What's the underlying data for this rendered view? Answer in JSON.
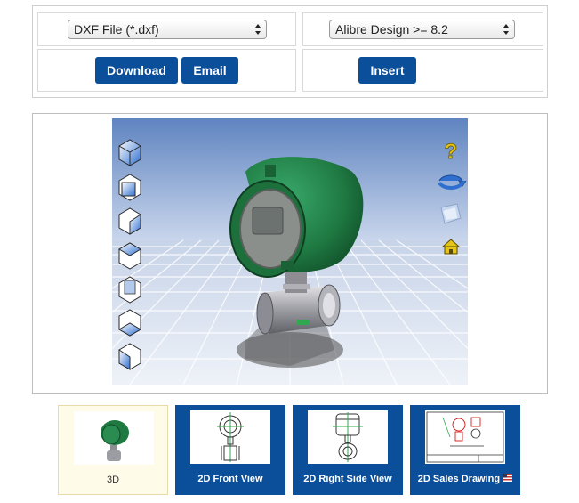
{
  "download_panel": {
    "format_select": {
      "value": "DXF File (*.dxf)"
    },
    "download_label": "Download",
    "email_label": "Email"
  },
  "insert_panel": {
    "cad_select": {
      "value": "Alibre Design >= 8.2"
    },
    "insert_label": "Insert"
  },
  "viewer": {
    "left_toolbar": [
      "view-cube-iso-icon",
      "view-cube-front-icon",
      "view-cube-right-icon",
      "view-cube-top-icon",
      "view-cube-back-icon",
      "view-cube-bottom-icon",
      "view-cube-left-icon"
    ],
    "right_toolbar": [
      "help-icon",
      "rotate-icon",
      "render-mode-icon",
      "home-icon"
    ],
    "help_glyph": "?",
    "colors": {
      "sky_top": "#5f84c0",
      "sky_bottom": "#c9d6ec",
      "floor": "#dfe6f2",
      "model_green": "#1f7a42",
      "accent": "#0b4f9a"
    }
  },
  "thumbnails": [
    {
      "label": "3D",
      "selected": true
    },
    {
      "label": "2D Front View",
      "selected": false
    },
    {
      "label": "2D Right Side View",
      "selected": false
    },
    {
      "label": "2D Sales Drawing",
      "selected": false
    }
  ]
}
